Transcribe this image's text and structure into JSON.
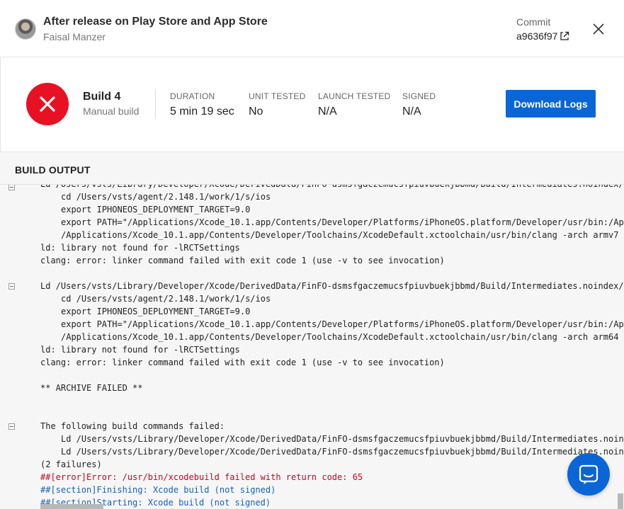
{
  "header": {
    "title": "After release on Play Store and App Store",
    "author": "Faisal Manzer",
    "commit_label": "Commit",
    "commit_hash": "a9636f97"
  },
  "summary": {
    "status": "failed",
    "build_name": "Build 4",
    "trigger": "Manual build",
    "stats": [
      {
        "label": "DURATION",
        "value": "5 min 19 sec"
      },
      {
        "label": "UNIT TESTED",
        "value": "No"
      },
      {
        "label": "LAUNCH TESTED",
        "value": "N/A"
      },
      {
        "label": "SIGNED",
        "value": "N/A"
      }
    ],
    "download_label": "Download Logs"
  },
  "output": {
    "title": "BUILD OUTPUT",
    "lines": [
      "Ld /Users/vsts/Library/Developer/Xcode/DerivedData/FinFO-dsmsfgaczemucsfpiuvbuekjbbmd/Build/Intermediates.noindex/",
      "cd /Users/vsts/agent/2.148.1/work/1/s/ios",
      "export IPHONEOS_DEPLOYMENT_TARGET=9.0",
      "export PATH=\"/Applications/Xcode_10.1.app/Contents/Developer/Platforms/iPhoneOS.platform/Developer/usr/bin:/Ap",
      "/Applications/Xcode_10.1.app/Contents/Developer/Toolchains/XcodeDefault.xctoolchain/usr/bin/clang -arch armv7",
      "ld: library not found for -lRCTSettings",
      "clang: error: linker command failed with exit code 1 (use -v to see invocation)",
      "Ld /Users/vsts/Library/Developer/Xcode/DerivedData/FinFO-dsmsfgaczemucsfpiuvbuekjbbmd/Build/Intermediates.noindex/",
      "cd /Users/vsts/agent/2.148.1/work/1/s/ios",
      "export IPHONEOS_DEPLOYMENT_TARGET=9.0",
      "export PATH=\"/Applications/Xcode_10.1.app/Contents/Developer/Platforms/iPhoneOS.platform/Developer/usr/bin:/Ap",
      "/Applications/Xcode_10.1.app/Contents/Developer/Toolchains/XcodeDefault.xctoolchain/usr/bin/clang -arch arm64",
      "ld: library not found for -lRCTSettings",
      "clang: error: linker command failed with exit code 1 (use -v to see invocation)",
      "** ARCHIVE FAILED **",
      "The following build commands failed:",
      "Ld /Users/vsts/Library/Developer/Xcode/DerivedData/FinFO-dsmsfgaczemucsfpiuvbuekjbbmd/Build/Intermediates.noin",
      "Ld /Users/vsts/Library/Developer/Xcode/DerivedData/FinFO-dsmsfgaczemucsfpiuvbuekjbbmd/Build/Intermediates.noin",
      "(2 failures)",
      "##[error]Error: /usr/bin/xcodebuild failed with return code: 65",
      "##[section]Finishing: Xcode build (not signed)",
      "##[section]Starting: Xcode build (not signed)"
    ]
  },
  "colors": {
    "accent": "#0a66d6",
    "error": "#e81123",
    "log_error": "#d1001f",
    "log_section": "#1a5fb4"
  },
  "icons": {
    "status": "close-x-icon",
    "external_link": "external-link-icon",
    "close": "close-icon",
    "chat": "chat-icon"
  }
}
